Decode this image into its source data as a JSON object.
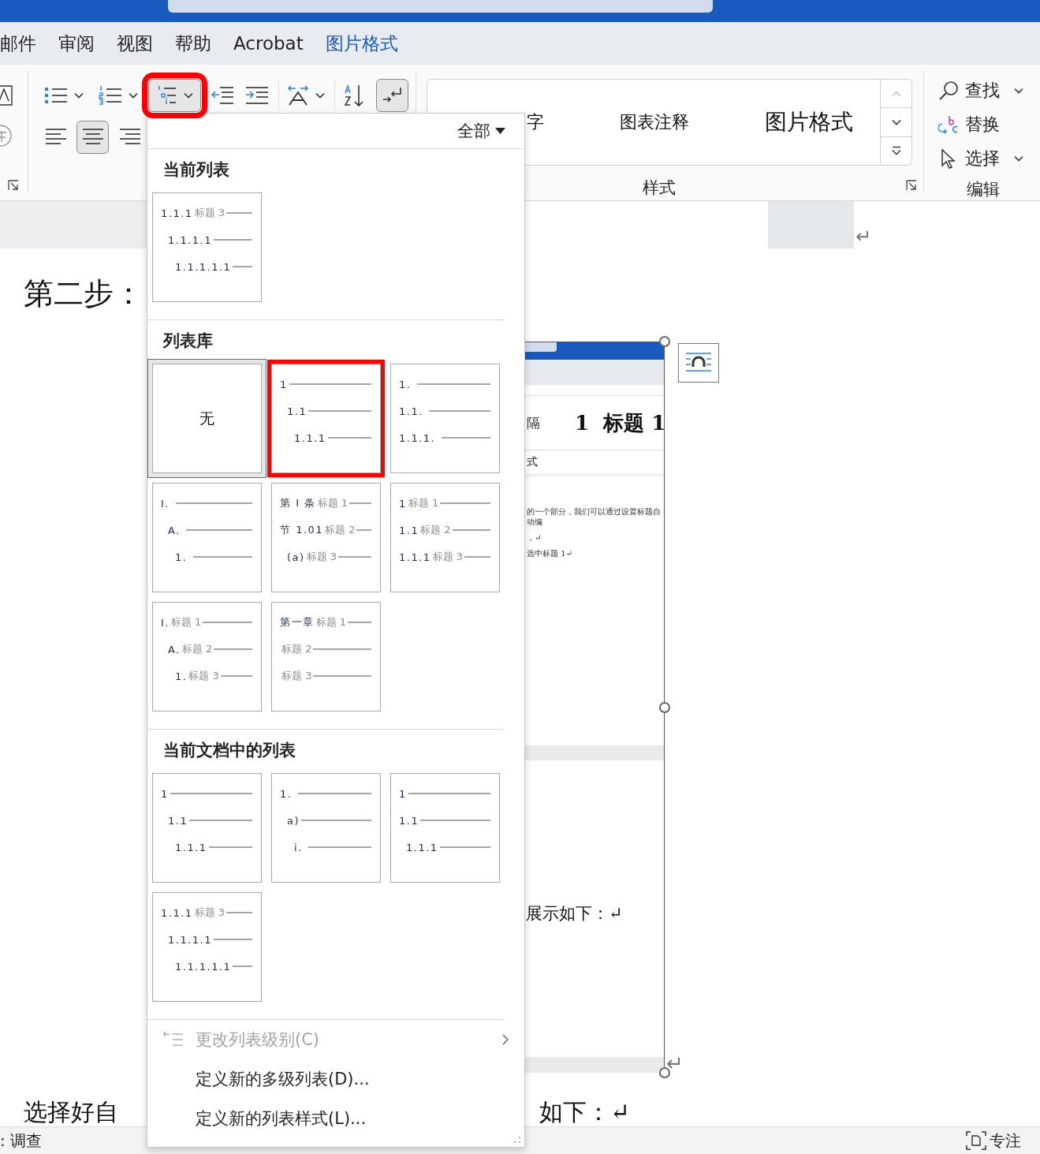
{
  "ribbon_tabs": [
    {
      "label": "邮件",
      "selected": false
    },
    {
      "label": "审阅",
      "selected": false
    },
    {
      "label": "视图",
      "selected": false
    },
    {
      "label": "帮助",
      "selected": false
    },
    {
      "label": "Acrobat",
      "selected": false
    },
    {
      "label": "图片格式",
      "selected": true
    }
  ],
  "ribbon": {
    "paragraph_tools": [
      {
        "kind": "bullets",
        "dropdown": true,
        "pressed": false,
        "highlighted": false
      },
      {
        "kind": "numbering",
        "dropdown": true,
        "pressed": false,
        "highlighted": false
      },
      {
        "kind": "multilevel",
        "dropdown": true,
        "pressed": true,
        "highlighted": true
      },
      {
        "kind": "outdent",
        "dropdown": false,
        "pressed": false,
        "highlighted": false
      },
      {
        "kind": "indent",
        "dropdown": false,
        "pressed": false,
        "highlighted": false
      },
      {
        "kind": "asian-layout",
        "dropdown": true,
        "pressed": false,
        "highlighted": false
      },
      {
        "kind": "sort",
        "dropdown": false,
        "pressed": false,
        "highlighted": false
      },
      {
        "kind": "marks",
        "dropdown": false,
        "pressed": true,
        "highlighted": false
      }
    ],
    "align_tools": [
      {
        "kind": "align-left",
        "pressed": false
      },
      {
        "kind": "center",
        "pressed": true
      },
      {
        "kind": "align-right",
        "pressed": false
      }
    ],
    "styles": {
      "items": [
        {
          "label": "字",
          "kind": "body"
        },
        {
          "label": "图表注释",
          "kind": "caption"
        },
        {
          "label": "图片格式",
          "kind": "title"
        }
      ],
      "group_label": "样式"
    },
    "editing": {
      "items": [
        {
          "kind": "find",
          "label": "查找",
          "dropdown": true
        },
        {
          "kind": "replace",
          "label": "替换",
          "dropdown": false
        },
        {
          "kind": "select",
          "label": "选择",
          "dropdown": true
        }
      ],
      "group_label": "编辑"
    }
  },
  "list_menu": {
    "filter": "全部",
    "sections": [
      {
        "title": "当前列表",
        "items": [
          {
            "kind": "outline",
            "hovered": false,
            "highlighted": false,
            "lines": [
              {
                "number": "1.1.1",
                "caption": "标题 3",
                "children": [
                  {
                    "number": "1.1.1.1",
                    "children": [
                      {
                        "number": "1.1.1.1.1"
                      }
                    ]
                  }
                ]
              }
            ]
          }
        ]
      },
      {
        "title": "列表库",
        "items": [
          {
            "kind": "none",
            "label": "无",
            "hovered": true,
            "highlighted": false
          },
          {
            "kind": "outline",
            "hovered": false,
            "highlighted": true,
            "lines": [
              {
                "number": "1",
                "children": [
                  {
                    "number": "1.1",
                    "children": [
                      {
                        "number": "1.1.1"
                      }
                    ]
                  }
                ]
              }
            ]
          },
          {
            "kind": "outline",
            "hovered": false,
            "highlighted": false,
            "lines": [
              {
                "number": "1. "
              },
              {
                "number": "1.1. "
              },
              {
                "number": "1.1.1. "
              }
            ]
          },
          {
            "kind": "outline",
            "hovered": false,
            "highlighted": false,
            "lines": [
              {
                "number": "I. ",
                "children": [
                  {
                    "number": "A. ",
                    "children": [
                      {
                        "number": "1. "
                      }
                    ]
                  }
                ]
              }
            ]
          },
          {
            "kind": "outline",
            "hovered": false,
            "highlighted": false,
            "lines": [
              {
                "number": "第 Ⅰ 条",
                "caption": "标题 1"
              },
              {
                "number": "节 1.01",
                "caption": "标题 2",
                "children": [
                  {
                    "number": "(a)",
                    "caption": "标题 3"
                  }
                ]
              }
            ]
          },
          {
            "kind": "outline",
            "hovered": false,
            "highlighted": false,
            "lines": [
              {
                "number": "1",
                "caption": "标题 1"
              },
              {
                "number": "1.1",
                "caption": "标题 2"
              },
              {
                "number": "1.1.1",
                "caption": "标题 3"
              }
            ]
          },
          {
            "kind": "outline",
            "hovered": false,
            "highlighted": false,
            "lines": [
              {
                "number": "I.",
                "caption": "标题 1",
                "children": [
                  {
                    "number": "A.",
                    "caption": "标题 2",
                    "children": [
                      {
                        "number": "1.",
                        "caption": "标题 3"
                      }
                    ]
                  }
                ]
              }
            ]
          },
          {
            "kind": "outline",
            "hovered": false,
            "highlighted": false,
            "lines": [
              {
                "number": "第一章",
                "caption": "标题 1"
              },
              {
                "caption": "标题 2"
              },
              {
                "caption": "标题 3"
              }
            ]
          }
        ]
      },
      {
        "title": "当前文档中的列表",
        "items": [
          {
            "kind": "outline",
            "hovered": false,
            "highlighted": false,
            "lines": [
              {
                "number": "1",
                "children": [
                  {
                    "number": "1.1",
                    "children": [
                      {
                        "number": "1.1.1"
                      }
                    ]
                  }
                ]
              }
            ]
          },
          {
            "kind": "outline",
            "hovered": false,
            "highlighted": false,
            "lines": [
              {
                "number": "1. ",
                "children": [
                  {
                    "number": "a)",
                    "children": [
                      {
                        "number": "i. "
                      }
                    ]
                  }
                ]
              }
            ]
          },
          {
            "kind": "outline",
            "hovered": false,
            "highlighted": false,
            "lines": [
              {
                "number": "1"
              },
              {
                "number": "1.1",
                "children": [
                  {
                    "number": "1.1.1"
                  }
                ]
              }
            ]
          },
          {
            "kind": "outline",
            "hovered": false,
            "highlighted": false,
            "lines": [
              {
                "number": "1.1.1",
                "caption": "标题 3",
                "children": [
                  {
                    "number": "1.1.1.1",
                    "children": [
                      {
                        "number": "1.1.1.1.1"
                      }
                    ]
                  }
                ]
              }
            ]
          }
        ]
      }
    ],
    "commands": [
      {
        "kind": "change-level",
        "label": "更改列表级别(C)",
        "disabled": true,
        "submenu": true
      },
      {
        "kind": "define-list",
        "label": "定义新的多级列表(D)...",
        "disabled": false,
        "submenu": false
      },
      {
        "kind": "define-style",
        "label": "定义新的列表样式(L)...",
        "disabled": false,
        "submenu": false
      }
    ]
  },
  "document": {
    "paragraph_mark": "↵",
    "step_heading": "第二步：",
    "picture_mark": "↵",
    "last_line": [
      "选择好自",
      "如下：↵"
    ],
    "embedded_screenshot": {
      "style_left": "隔",
      "style_heading": "1  标题 1",
      "style_row": "式",
      "excerpt_lines": [
        "的一个部分，我们可以通过设置标题自动编",
        "，↵",
        "选中标题 1↵"
      ],
      "caption": "展示如下：↵"
    }
  },
  "status_bar": {
    "left": ": 调查",
    "focus": "专注"
  }
}
